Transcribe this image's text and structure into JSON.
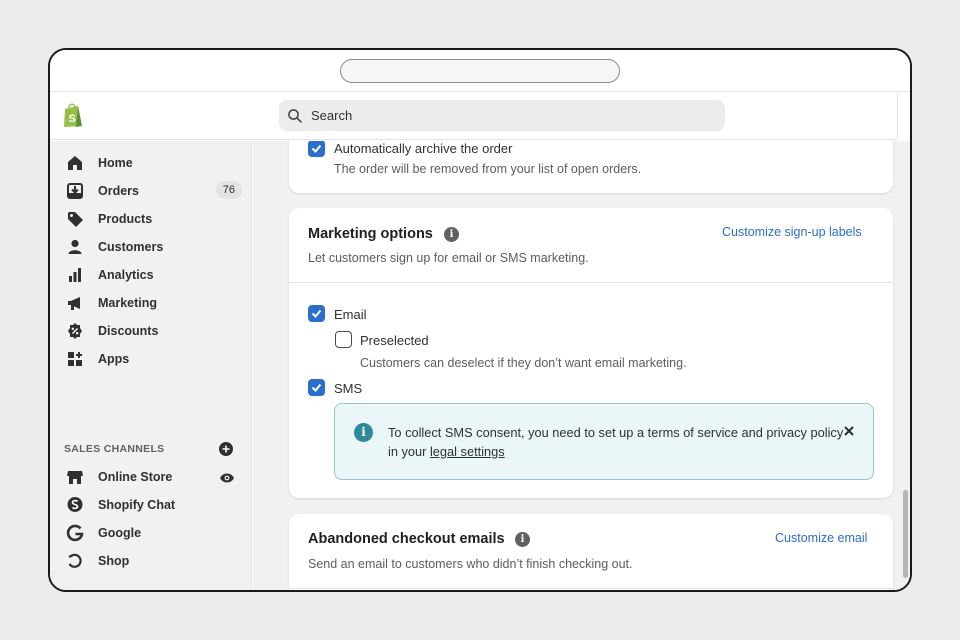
{
  "search": {
    "placeholder": "Search"
  },
  "sidebar": {
    "items": [
      {
        "label": "Home",
        "icon": "home-icon"
      },
      {
        "label": "Orders",
        "icon": "orders-icon",
        "badge": "76"
      },
      {
        "label": "Products",
        "icon": "tag-icon"
      },
      {
        "label": "Customers",
        "icon": "person-icon"
      },
      {
        "label": "Analytics",
        "icon": "bar-chart-icon"
      },
      {
        "label": "Marketing",
        "icon": "megaphone-icon"
      },
      {
        "label": "Discounts",
        "icon": "discount-icon"
      },
      {
        "label": "Apps",
        "icon": "apps-icon"
      }
    ],
    "section_title": "SALES CHANNELS",
    "channels": [
      {
        "label": "Online Store",
        "icon": "store-icon"
      },
      {
        "label": "Shopify Chat",
        "icon": "chat-icon"
      },
      {
        "label": "Google",
        "icon": "google-icon"
      },
      {
        "label": "Shop",
        "icon": "shop-icon"
      }
    ]
  },
  "archive": {
    "label": "Automatically archive the order",
    "description": "The order will be removed from your list of open orders."
  },
  "marketing": {
    "title": "Marketing options",
    "link": "Customize sign-up labels",
    "description": "Let customers sign up for email or SMS marketing.",
    "email_label": "Email",
    "preselected_label": "Preselected",
    "preselected_help": "Customers can deselect if they don’t want email marketing.",
    "sms_label": "SMS",
    "banner_text": "To collect SMS consent, you need to set up a terms of service and privacy policy in your ",
    "banner_link": "legal settings"
  },
  "abandoned": {
    "title": "Abandoned checkout emails",
    "link": "Customize email",
    "description": "Send an email to customers who didn’t finish checking out."
  },
  "colors": {
    "accent": "#2c6ecb",
    "banner_bg": "#eaf6f7",
    "sidebar_bg": "#f1f1f2"
  }
}
